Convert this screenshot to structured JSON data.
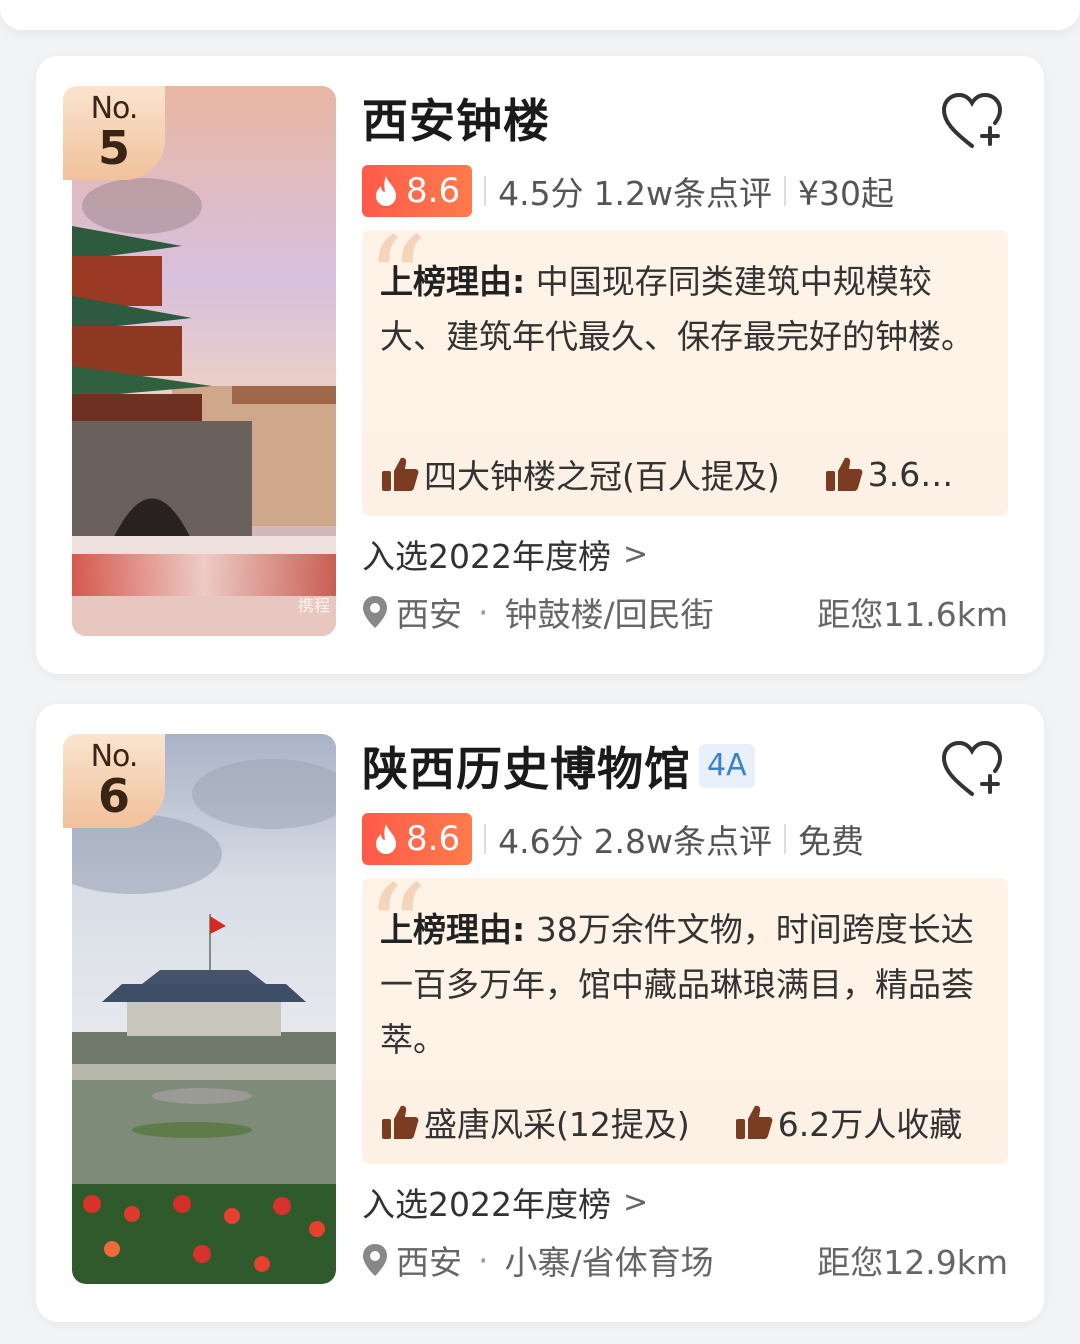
{
  "cards": [
    {
      "rank_prefix": "No.",
      "rank": "5",
      "watermark": "携程",
      "title": "西安钟楼",
      "grade": "",
      "heat": "8.6",
      "score": "4.5分",
      "reviews": "1.2w条点评",
      "price": "¥30起",
      "reason_label": "上榜理由:",
      "reason_text": "中国现存同类建筑中规模较大、建筑年代最久、保存最完好的钟楼。",
      "tags": [
        "四大钟楼之冠(百人提及)",
        "3.6…"
      ],
      "award": "入选2022年度榜",
      "city": "西安",
      "area": "钟鼓楼/回民街",
      "distance": "距您11.6km"
    },
    {
      "rank_prefix": "No.",
      "rank": "6",
      "watermark": "",
      "title": "陕西历史博物馆",
      "grade": "4A",
      "heat": "8.6",
      "score": "4.6分",
      "reviews": "2.8w条点评",
      "price": "免费",
      "reason_label": "上榜理由:",
      "reason_text": "38万余件文物，时间跨度长达一百多万年，馆中藏品琳琅满目，精品荟萃。",
      "tags": [
        "盛唐风采(12提及)",
        "6.2万人收藏"
      ],
      "award": "入选2022年度榜",
      "city": "西安",
      "area": "小寨/省体育场",
      "distance": "距您12.9km"
    }
  ],
  "colors": {
    "heat_badge": "#ff5a4a",
    "badge_gold": "#f1c19b",
    "reason_bg": "#fff3e8",
    "grade_text": "#3d7fd0"
  },
  "icons": [
    "heart-plus-icon",
    "flame-icon",
    "thumbs-up-icon",
    "location-pin-icon",
    "chevron-right-icon"
  ]
}
